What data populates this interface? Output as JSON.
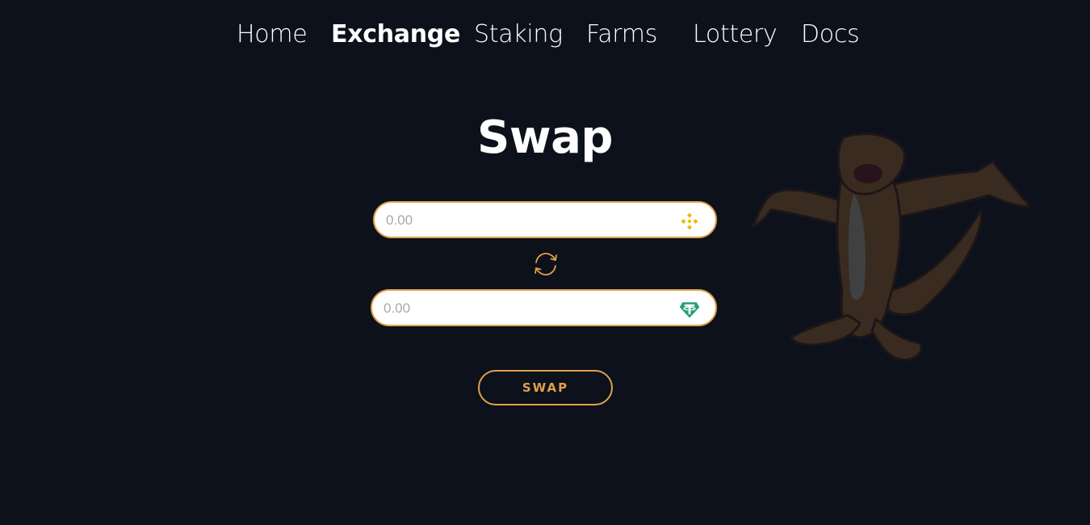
{
  "nav": {
    "items": [
      {
        "label": "Home",
        "active": false
      },
      {
        "label": "Exchange",
        "active": true
      },
      {
        "label": "Staking",
        "active": false
      },
      {
        "label": "Farms",
        "active": false
      },
      {
        "label": "Lottery",
        "active": false
      },
      {
        "label": "Docs",
        "active": false
      }
    ]
  },
  "swap": {
    "title": "Swap",
    "from": {
      "placeholder": "0.00",
      "token_icon": "bnb-icon"
    },
    "to": {
      "placeholder": "0.00",
      "token_icon": "tether-icon"
    },
    "direction_icon": "swap-direction-icon",
    "button_label": "SWAP"
  },
  "mascot": {
    "icon": "meerkat-mascot"
  },
  "colors": {
    "background": "#0c111b",
    "accent": "#e1a04c",
    "bnb": "#f0b90b",
    "tether": "#26a17b",
    "text": "#ffffff"
  }
}
